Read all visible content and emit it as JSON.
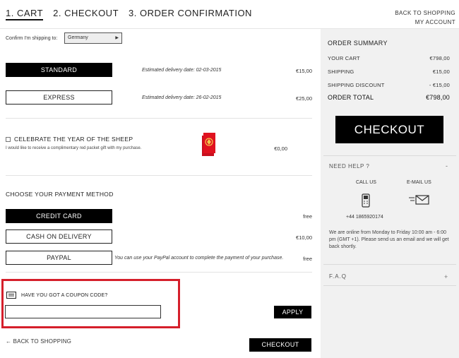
{
  "steps": [
    "1. CART",
    "2. CHECKOUT",
    "3. ORDER CONFIRMATION"
  ],
  "top_links": {
    "back_to_shopping": "BACK TO SHOPPING",
    "my_account": "MY ACCOUNT"
  },
  "shipping": {
    "label": "Confirm I'm shipping to:",
    "country": "Germany",
    "options": [
      {
        "label": "STANDARD",
        "delivery": "Estimated delivery date: 02-03-2015",
        "price": "€15,00",
        "selected": true
      },
      {
        "label": "EXPRESS",
        "delivery": "Estimated delivery date: 26-02-2015",
        "price": "€25,00",
        "selected": false
      }
    ]
  },
  "promo": {
    "title": "CELEBRATE THE YEAR OF THE SHEEP",
    "subtitle": "I would like to receive a complimentary red packet gift with my purchase.",
    "price": "€0,00"
  },
  "payment": {
    "title": "CHOOSE YOUR PAYMENT METHOD",
    "methods": [
      {
        "label": "CREDIT CARD",
        "note": "",
        "price": "free",
        "selected": true
      },
      {
        "label": "CASH ON DELIVERY",
        "note": "",
        "price": "€10,00",
        "selected": false
      },
      {
        "label": "PAYPAL",
        "note": "You can use your PayPal account to complete the payment of your purchase.",
        "price": "free",
        "selected": false
      }
    ]
  },
  "coupon": {
    "title": "HAVE YOU GOT A COUPON CODE?",
    "value": "",
    "apply": "APPLY"
  },
  "footer": {
    "back": "←   BACK TO SHOPPING",
    "checkout": "CHECKOUT"
  },
  "summary": {
    "title": "ORDER SUMMARY",
    "rows": [
      {
        "label": "YOUR CART",
        "value": "€798,00"
      },
      {
        "label": "SHIPPING",
        "value": "€15,00"
      },
      {
        "label": "SHIPPING DISCOUNT",
        "value": "- €15,00"
      }
    ],
    "total_label": "ORDER TOTAL",
    "total_value": "€798,00",
    "checkout": "CHECKOUT"
  },
  "help": {
    "title": "NEED HELP ?",
    "toggle": "-",
    "call_label": "CALL US",
    "email_label": "E-MAIL US",
    "phone": "+44 1865920174",
    "online": "We are online from Monday to Friday 10:00 am - 6:00 pm (GMT +1). Please send us an email and we will get back shortly.",
    "faq": "F.A.Q",
    "faq_toggle": "+"
  },
  "icons": {
    "phone": "phone-icon",
    "mail": "mail-icon",
    "coupon": "coupon-icon",
    "red_packet": "red-packet-image"
  },
  "colors": {
    "highlight": "#d51f2b",
    "primary": "#000000",
    "sidebar": "#f1f1f1"
  }
}
